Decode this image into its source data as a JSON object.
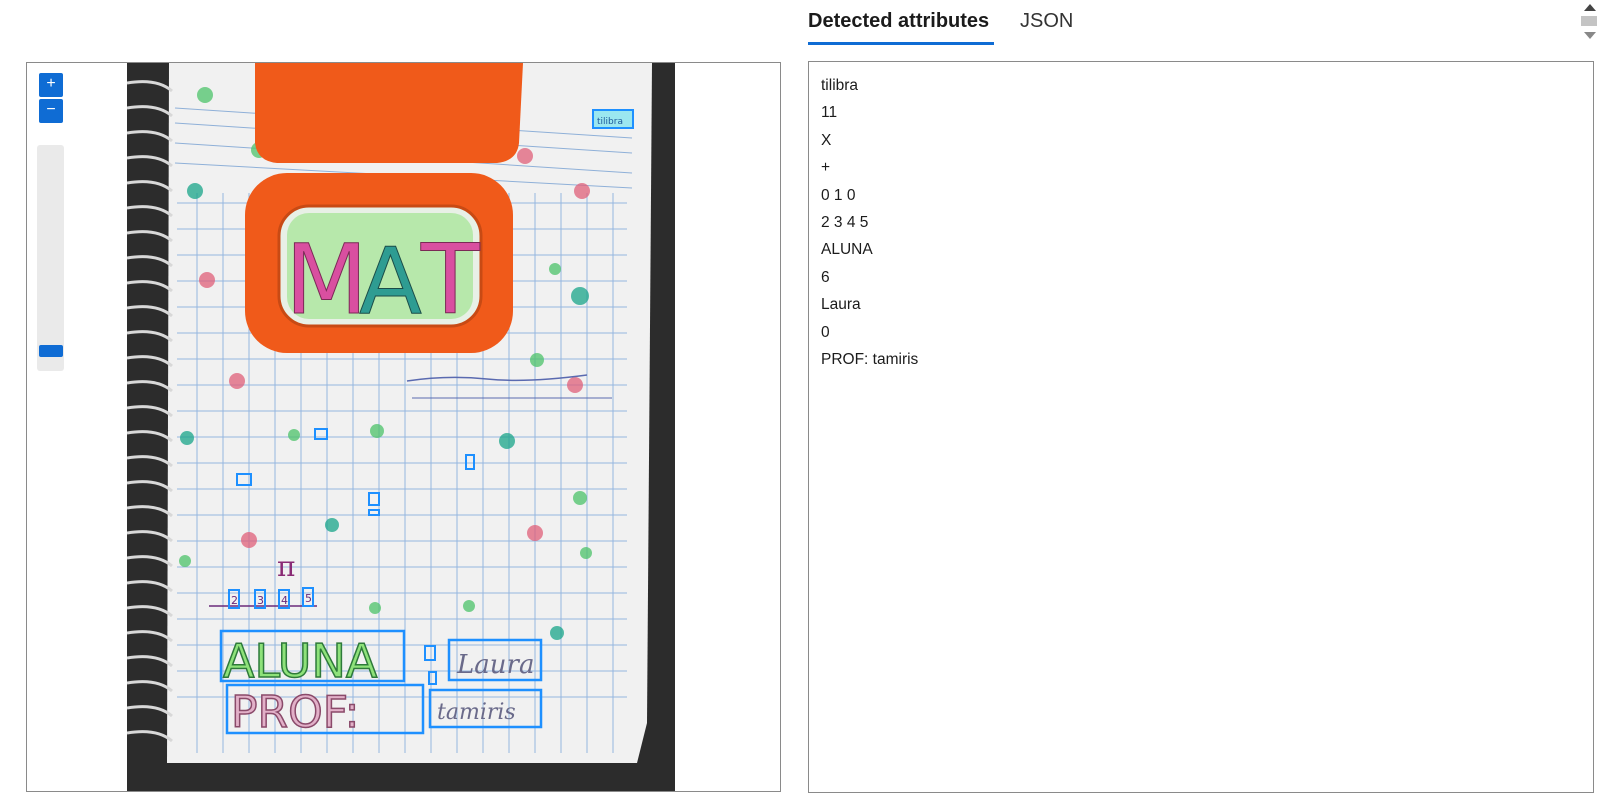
{
  "tabs": [
    {
      "label": "Detected attributes",
      "active": true
    },
    {
      "label": "JSON",
      "active": false
    }
  ],
  "viewer": {
    "zoom_in_icon": "plus-icon",
    "zoom_out_icon": "minus-icon",
    "zoom_level": 0.05
  },
  "attributes": [
    "tilibra",
    "11",
    "X",
    "+",
    "0 1 0",
    "2 3 4 5",
    "ALUNA",
    "6",
    "Laura",
    "0",
    "PROF: tamiris"
  ],
  "photo_texts": {
    "title_m": "M",
    "title_a": "A",
    "title_t": "T",
    "brand": "tilibra",
    "pi": "π",
    "aluna": "ALUNA",
    "laura": "Laura",
    "prof": "PROF:",
    "tamiris": "tamiris",
    "numbers": [
      "2",
      "3",
      "4",
      "5"
    ]
  },
  "colors": {
    "accent": "#0f6cd4",
    "box": "#1e90ff",
    "lid": "#f05a1a"
  }
}
